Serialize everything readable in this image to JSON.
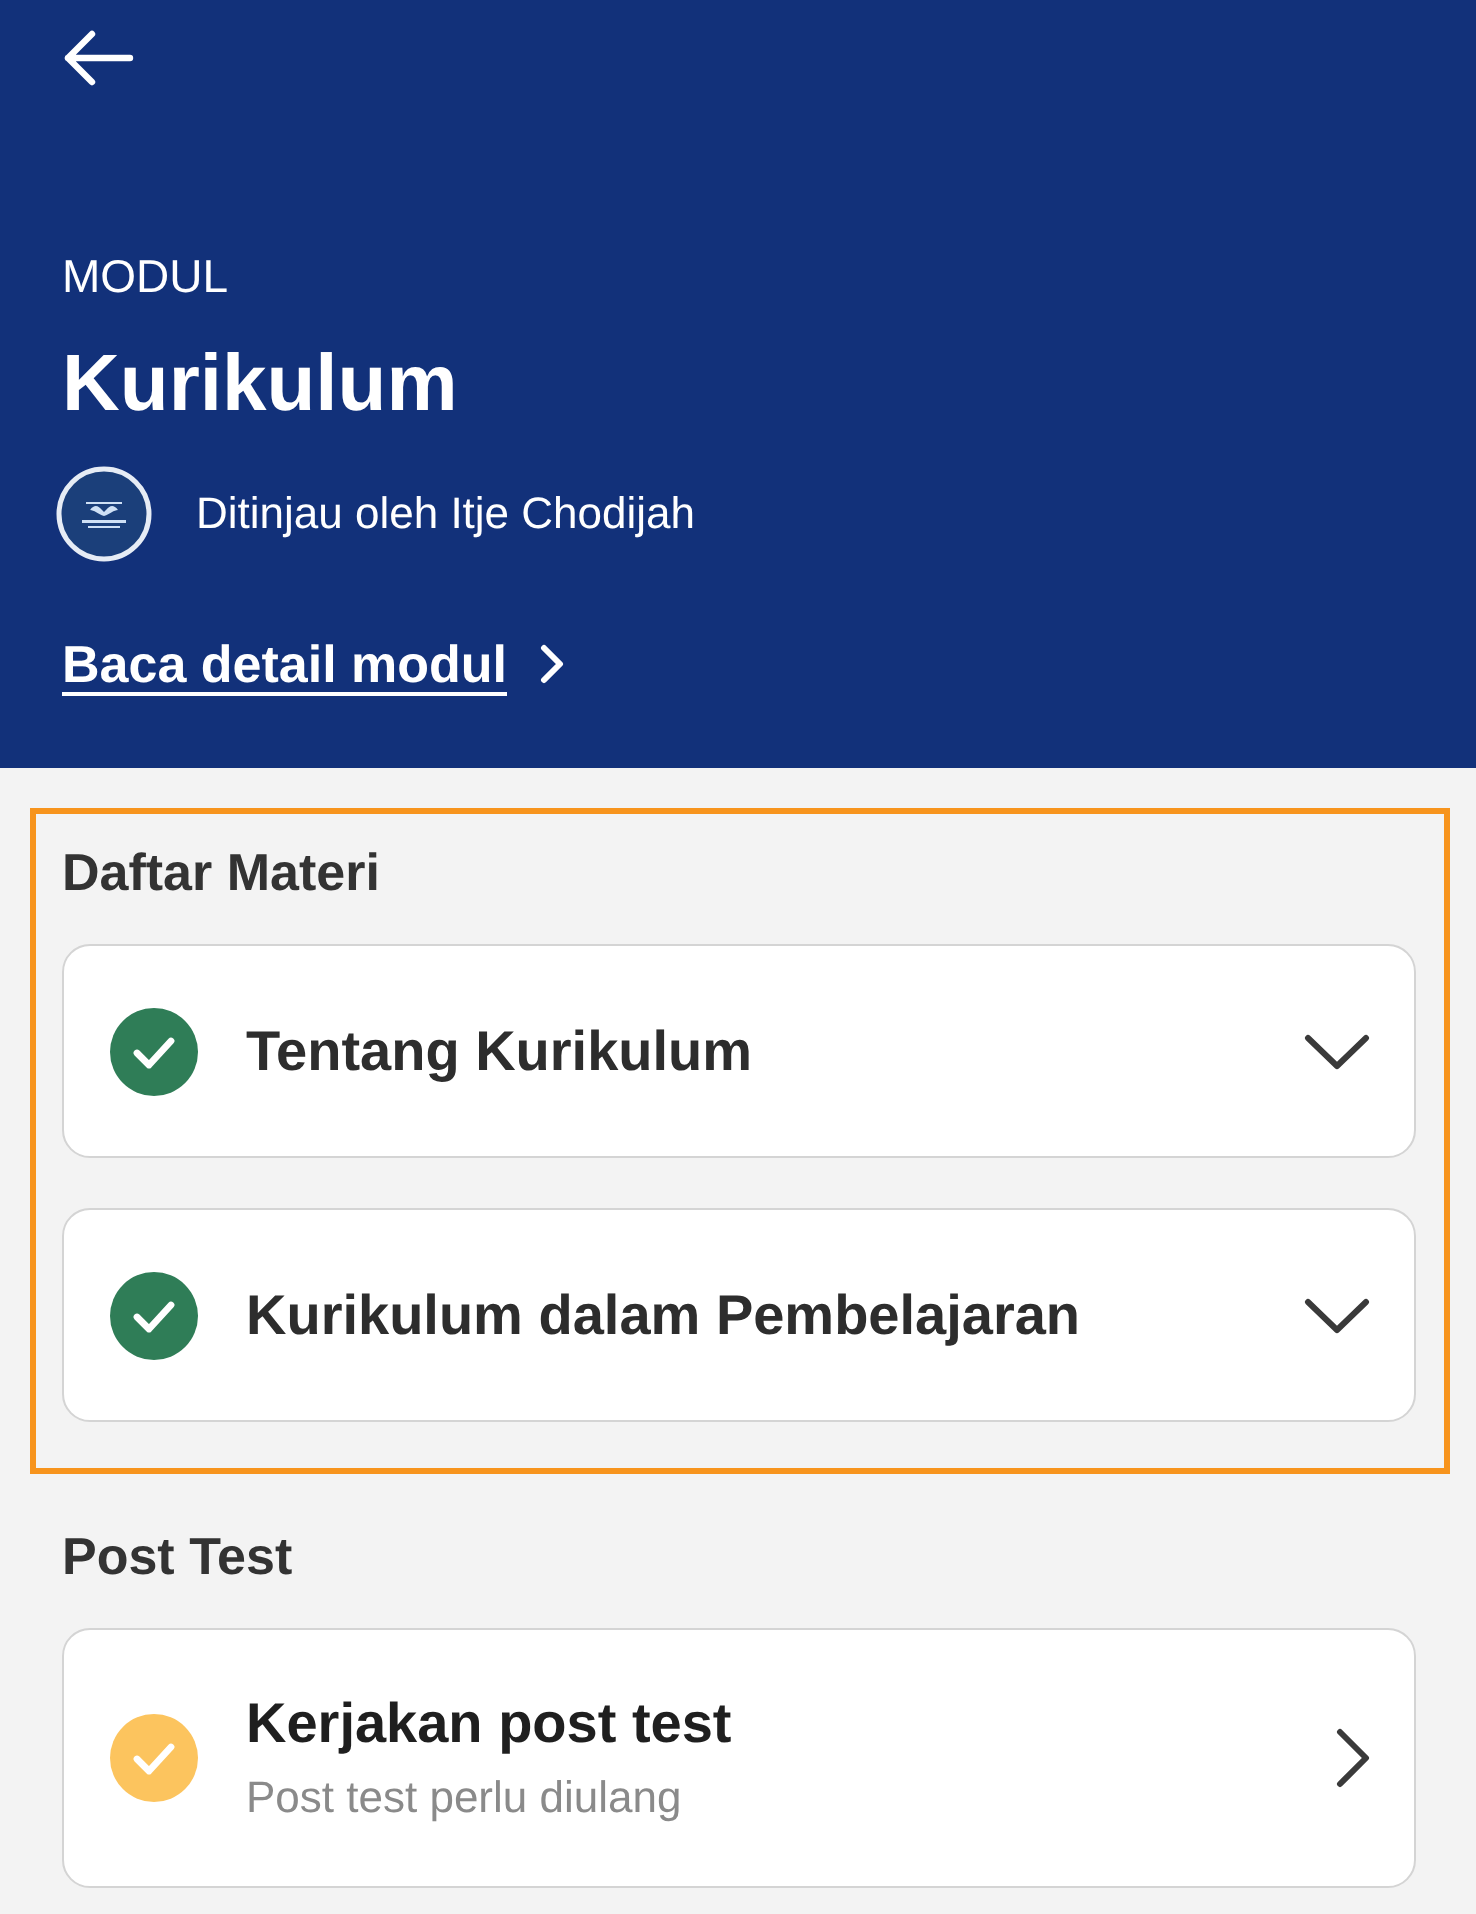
{
  "header": {
    "eyebrow": "MODUL",
    "title": "Kurikulum",
    "reviewer": "Ditinjau oleh Itje Chodijah",
    "detail_link": "Baca detail modul"
  },
  "sections": [
    {
      "title": "Daftar Materi",
      "highlighted": true,
      "items": [
        {
          "kind": "accordion",
          "title": "Tentang Kurikulum",
          "color": "#2f7d57",
          "expanded": false
        },
        {
          "kind": "accordion",
          "title": "Kurikulum dalam Pembelajaran",
          "color": "#2f7d57",
          "expanded": false
        }
      ]
    },
    {
      "title": "Post Test",
      "highlighted": false,
      "items": [
        {
          "kind": "link",
          "title": "Kerjakan post test",
          "subtitle": "Post test perlu diulang",
          "color": "#fcc45e"
        }
      ]
    }
  ]
}
